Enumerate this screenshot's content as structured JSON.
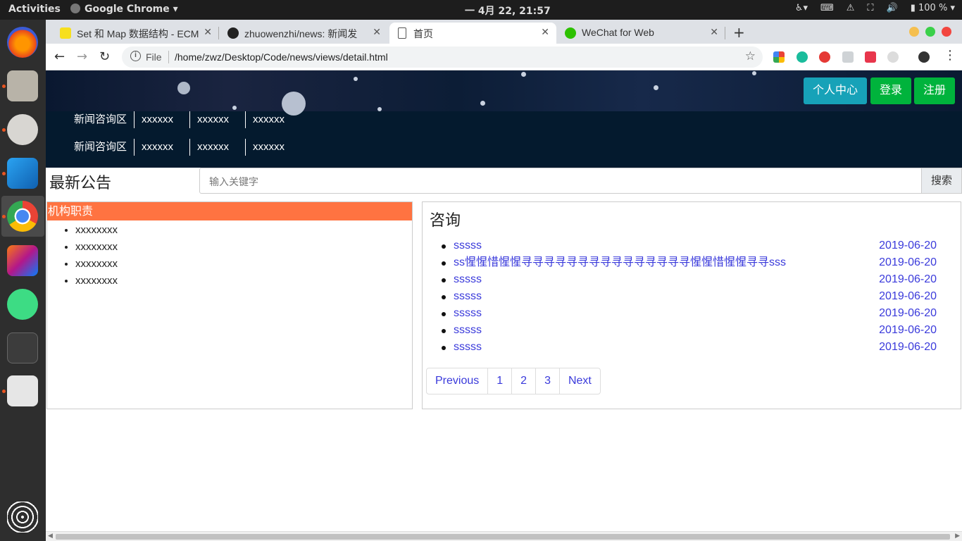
{
  "os": {
    "activities": "Activities",
    "app_name": "Google Chrome",
    "clock": "一 4月 22, 21:57",
    "battery": "100 %"
  },
  "browser": {
    "tabs": [
      {
        "title": "Set 和 Map 数据结构 - ECM",
        "favicon": "es-icon"
      },
      {
        "title": "zhuowenzhi/news: 新闻发",
        "favicon": "github-icon"
      },
      {
        "title": "首页",
        "favicon": "page-icon",
        "active": true
      },
      {
        "title": "WeChat for Web",
        "favicon": "wechat-icon"
      }
    ],
    "scheme_label": "File",
    "url": "/home/zwz/Desktop/Code/news/views/detail.html"
  },
  "page": {
    "header_buttons": {
      "profile": "个人中心",
      "login": "登录",
      "register": "注册"
    },
    "nav_rows": [
      [
        "新闻咨询区",
        "xxxxxx",
        "xxxxxx",
        "xxxxxx"
      ],
      [
        "新闻咨询区",
        "xxxxxx",
        "xxxxxx",
        "xxxxxx"
      ]
    ],
    "announce_title": "最新公告",
    "search": {
      "placeholder": "输入关键字",
      "button": "搜索"
    },
    "left_panel": {
      "title": "机构职责",
      "items": [
        "xxxxxxxx",
        "xxxxxxxx",
        "xxxxxxxx",
        "xxxxxxxx"
      ]
    },
    "right_panel": {
      "title": "咨询",
      "news": [
        {
          "title": "sssss",
          "date": "2019-06-20"
        },
        {
          "title": "ss惺惺惜惺惺寻寻寻寻寻寻寻寻寻寻寻寻寻寻寻惺惺惜惺惺寻寻sss",
          "date": "2019-06-20"
        },
        {
          "title": "sssss",
          "date": "2019-06-20"
        },
        {
          "title": "sssss",
          "date": "2019-06-20"
        },
        {
          "title": "sssss",
          "date": "2019-06-20"
        },
        {
          "title": "sssss",
          "date": "2019-06-20"
        },
        {
          "title": "sssss",
          "date": "2019-06-20"
        }
      ],
      "pagination": [
        "Previous",
        "1",
        "2",
        "3",
        "Next"
      ]
    }
  },
  "colors": {
    "profile_btn": "#17a2b8",
    "login_btn": "#00b33c",
    "register_btn": "#00b33c",
    "section_head": "#ff7341",
    "link": "#3a3adb"
  }
}
